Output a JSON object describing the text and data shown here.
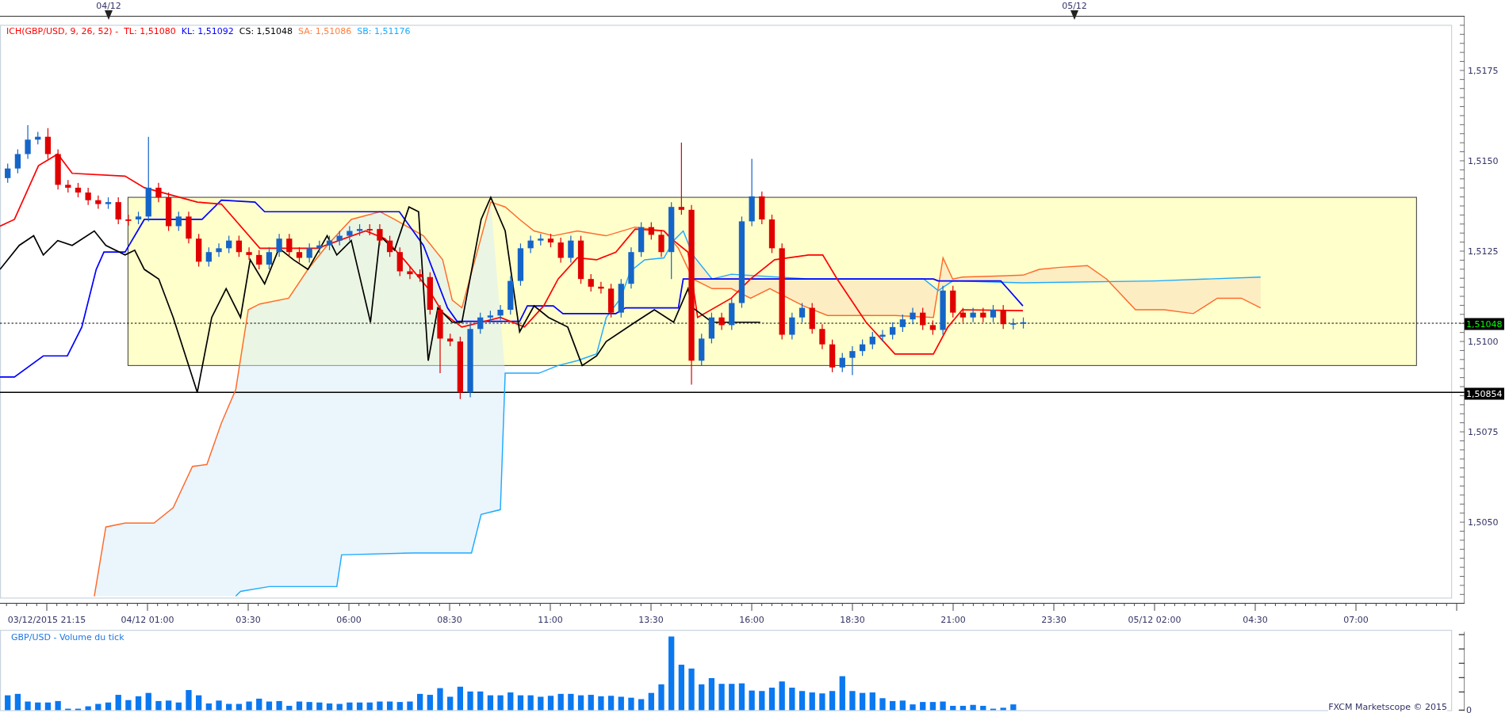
{
  "date_bar": {
    "markers": [
      {
        "label": "04/12"
      },
      {
        "label": "05/12"
      }
    ]
  },
  "legend": {
    "indicator": "ICH(GBP/USD, 9, 26, 52) -",
    "values": [
      {
        "label": "TL: 1,51080",
        "color": "#ff0000"
      },
      {
        "label": "KL: 1,51092",
        "color": "#0000ff"
      },
      {
        "label": "CS: 1,51048",
        "color": "#000000"
      },
      {
        "label": "SA: 1,51086",
        "color": "#ff7f3f"
      },
      {
        "label": "SB: 1,51176",
        "color": "#1eaaff"
      }
    ]
  },
  "price_axis": {
    "ticks": [
      "1,5175",
      "1,5150",
      "1,5125",
      "1,5100",
      "1,5075",
      "1,5050"
    ]
  },
  "price_tags": [
    {
      "label": "1,51048",
      "kind": "last"
    },
    {
      "label": "1,50854",
      "kind": "line"
    }
  ],
  "time_axis": {
    "labels": [
      "03/12/2015 21:15",
      "04/12 01:00",
      "03:30",
      "06:00",
      "08:30",
      "11:00",
      "13:30",
      "16:00",
      "18:30",
      "21:00",
      "23:30",
      "05/12 02:00",
      "04:30",
      "07:00"
    ]
  },
  "volume_panel": {
    "title": "GBP/USD - Volume du tick",
    "axis_label": "0",
    "credit": "FXCM Marketscope © 2015"
  }
}
